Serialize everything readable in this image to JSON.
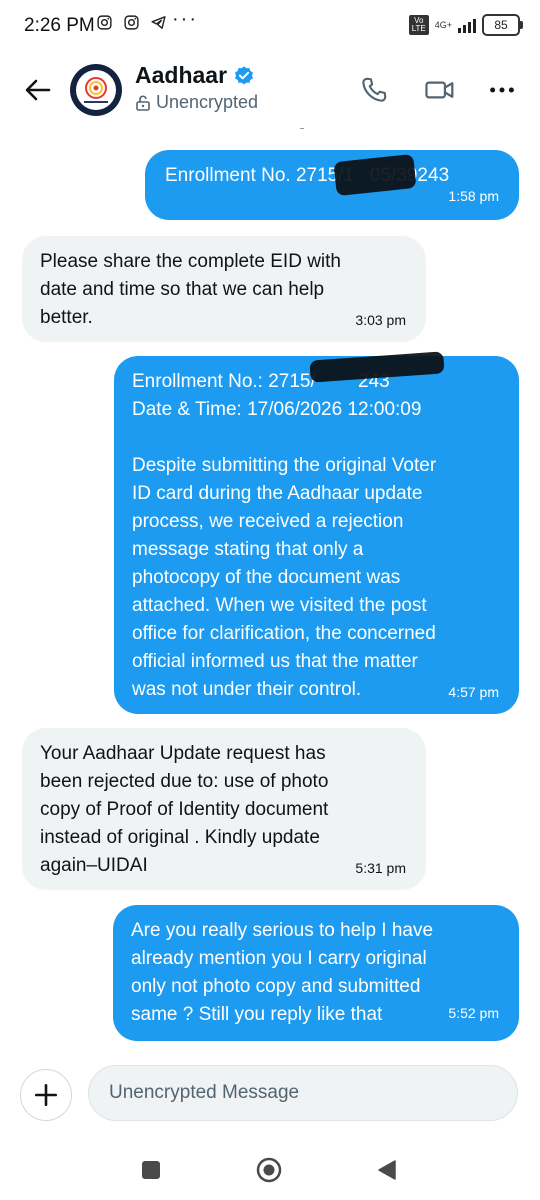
{
  "status_bar": {
    "time": "2:26 PM",
    "icons_left": [
      "instagram-icon",
      "instagram-icon",
      "telegram-icon"
    ],
    "overflow": "···",
    "volte": "Vo LTE",
    "network": "4G+",
    "battery": "85"
  },
  "header": {
    "title": "Aadhaar",
    "verified": true,
    "subtitle": "Unencrypted",
    "actions": [
      "phone-icon",
      "video-icon",
      "more-icon"
    ]
  },
  "messages": [
    {
      "direction": "outgoing",
      "text": "Enrollment No. 2715/1   05/39243",
      "time": "1:58 pm"
    },
    {
      "direction": "incoming",
      "text": "Please share the complete EID with\ndate and time so that we can help\nbetter.",
      "time": "3:03 pm"
    },
    {
      "direction": "outgoing",
      "text": "Enrollment No.: 2715/        243\nDate & Time: 17/06/2026 12:00:09\n\nDespite submitting the original Voter\nID card during the Aadhaar update\nprocess, we received a rejection\nmessage stating that only a\nphotocopy of the document was\nattached. When we visited the post\noffice for clarification, the concerned\nofficial informed us that the matter\nwas not under their control.",
      "time": "4:57 pm"
    },
    {
      "direction": "incoming",
      "text": "Your Aadhaar Update request has\nbeen rejected due to: use of photo\ncopy of Proof of Identity document\ninstead of original . Kindly update\nagain–UIDAI",
      "time": "5:31 pm"
    },
    {
      "direction": "outgoing",
      "text": "Are you really serious to help I have\nalready mention you I carry original\nonly not photo copy and submitted\nsame ? Still you reply like that",
      "time": "5:52 pm"
    }
  ],
  "composer": {
    "placeholder": "Unencrypted Message"
  },
  "colors": {
    "accent": "#1d9bf0",
    "incoming_bubble": "#eff3f4",
    "text": "#0f1419",
    "secondary_text": "#536471"
  }
}
